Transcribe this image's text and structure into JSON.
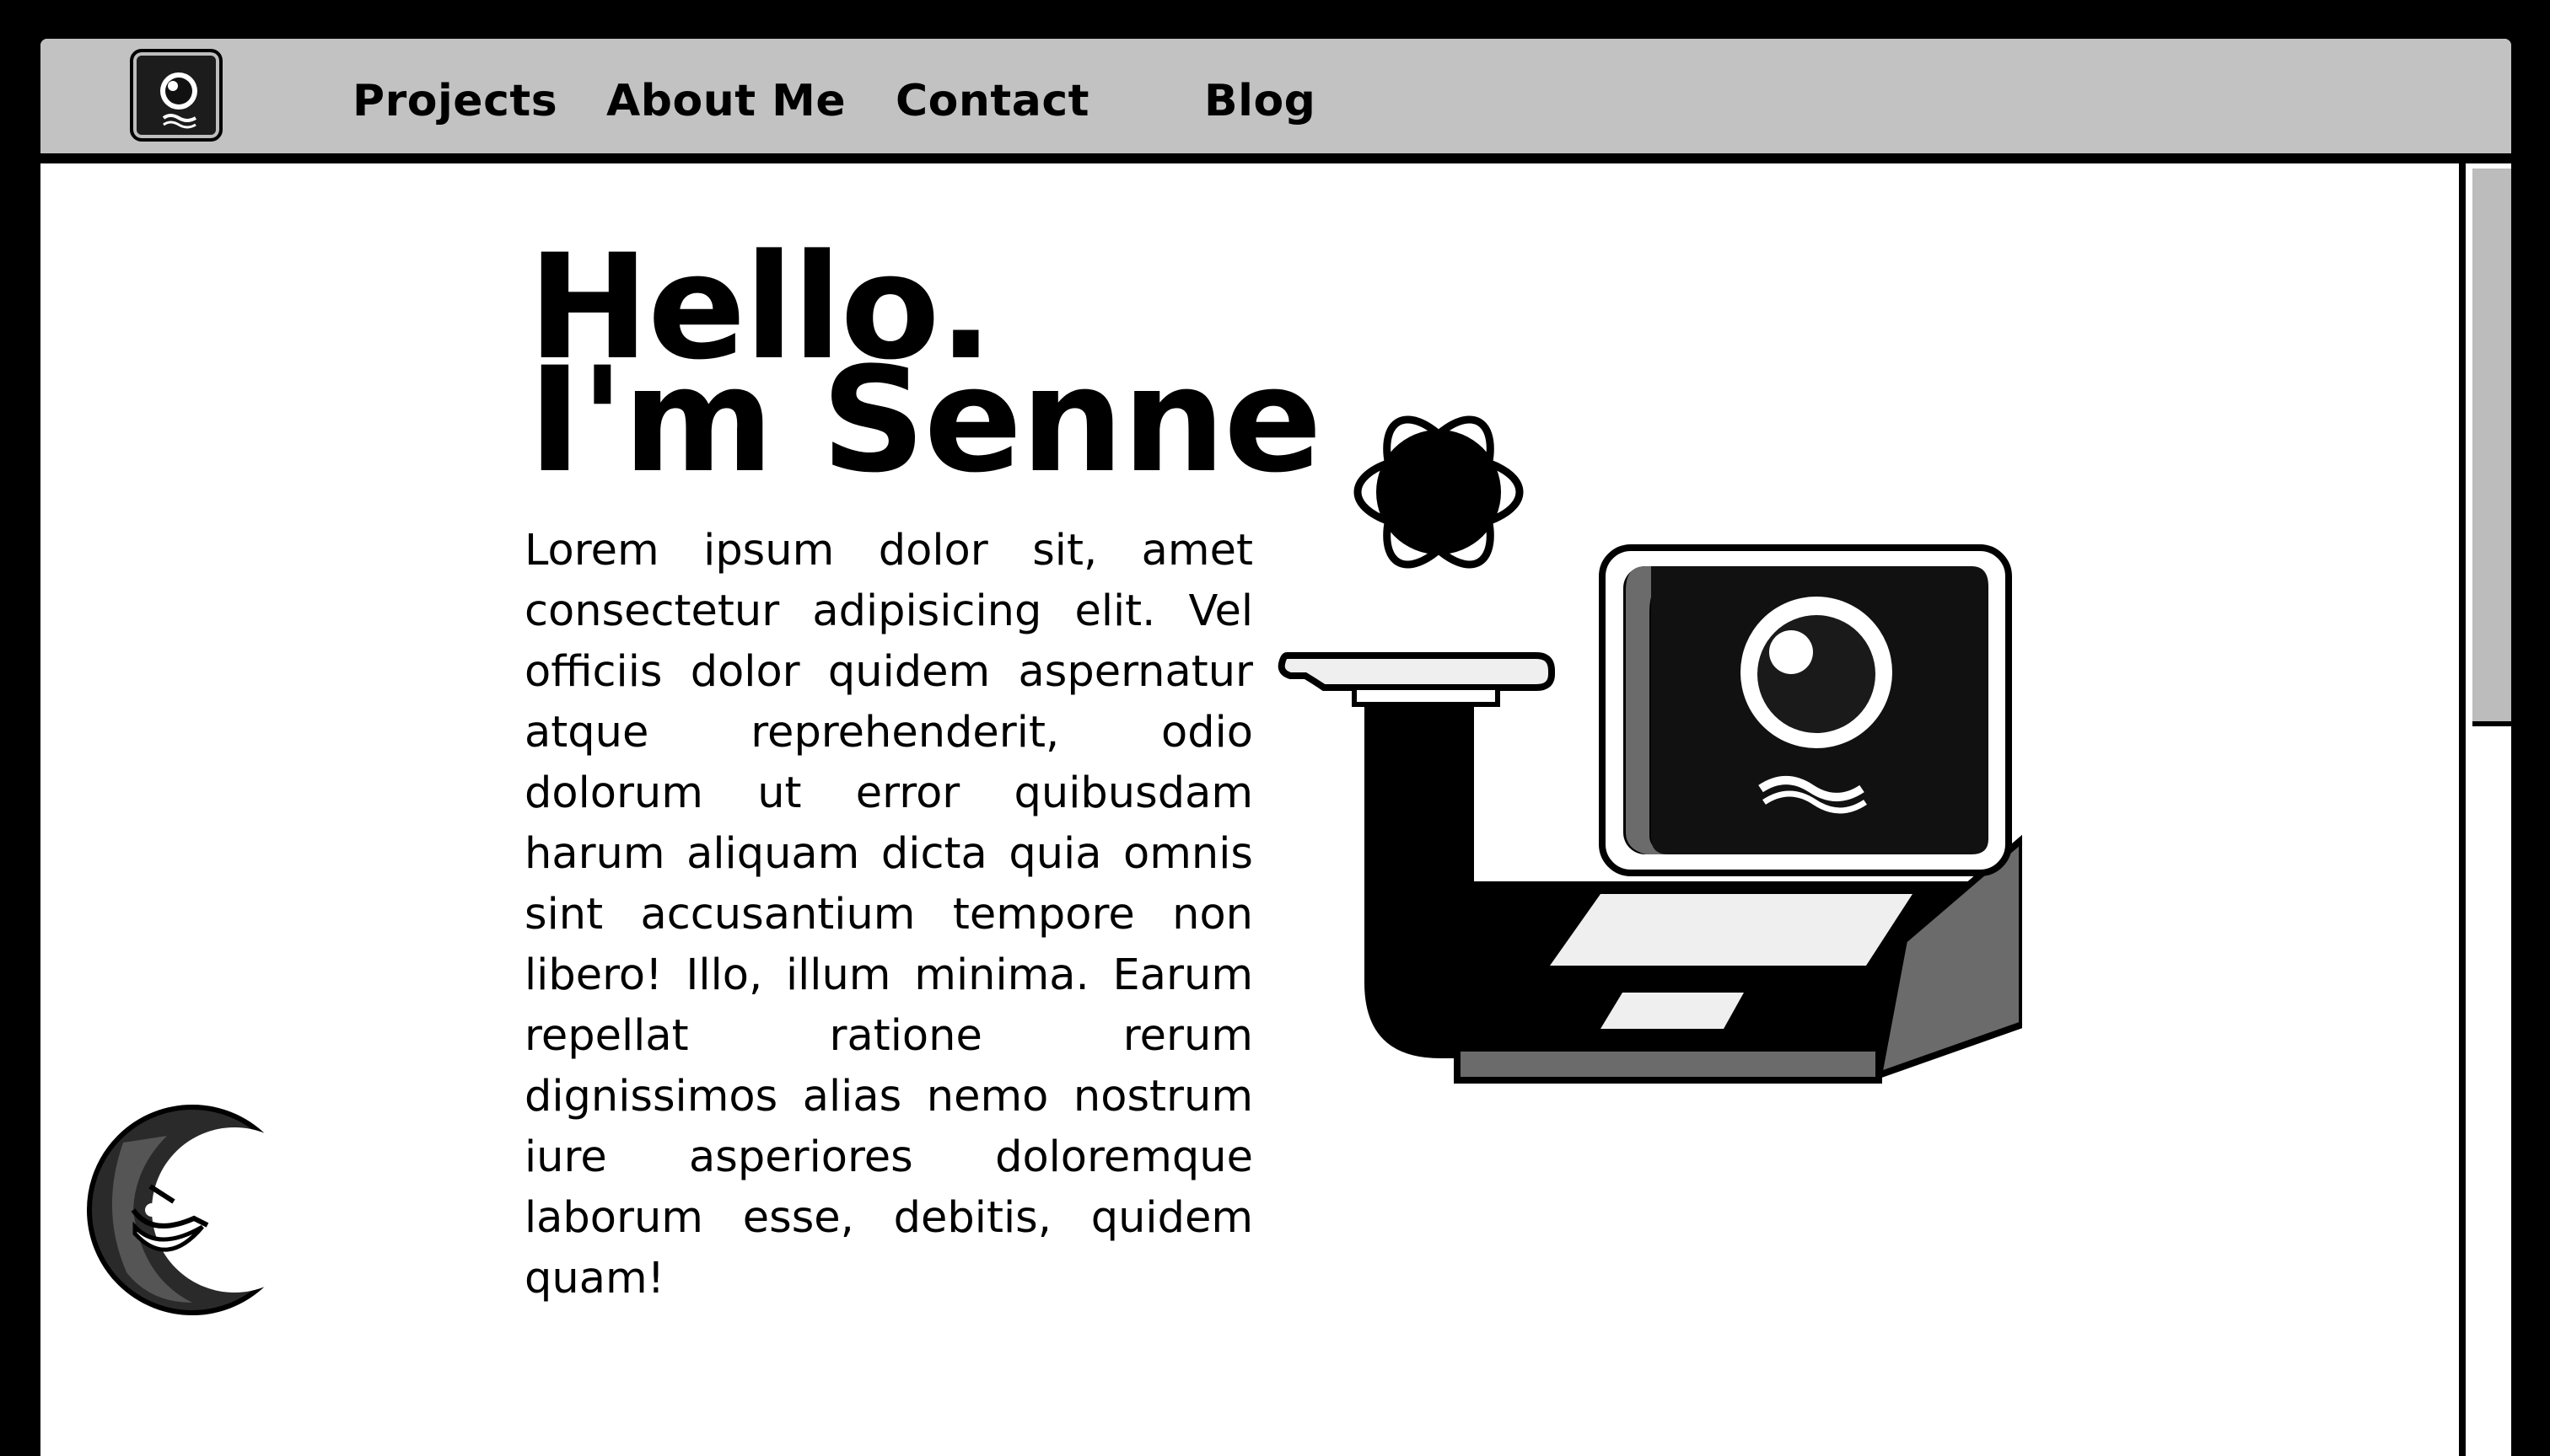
{
  "nav": {
    "logo_icon": "eye-face-logo-icon",
    "items": [
      {
        "label": "Projects"
      },
      {
        "label": "About Me"
      },
      {
        "label": "Contact"
      },
      {
        "label": "Blog"
      }
    ]
  },
  "hero": {
    "title_line1": "Hello.",
    "title_line2": "I'm Senne",
    "body": "Lorem ipsum dolor sit, amet consectetur adipisicing elit. Vel officiis dolor quidem aspernatur atque reprehenderit, odio dolorum ut error quibusdam harum aliquam dicta quia omnis sint accusantium tempore non libero! Illo, illum minima. Earum repellat ratione rerum dignissimos alias nemo nostrum iure asperiores doloremque laborum esse, debitis, quidem quam!"
  },
  "illustration": {
    "icon": "computer-character-holding-atom-icon"
  },
  "moon": {
    "icon": "grinning-moon-icon"
  },
  "colors": {
    "background": "#000000",
    "navbar": "#c2c2c2",
    "page": "#ffffff",
    "scroll_thumb": "#bcbcbc",
    "ink": "#000000"
  }
}
